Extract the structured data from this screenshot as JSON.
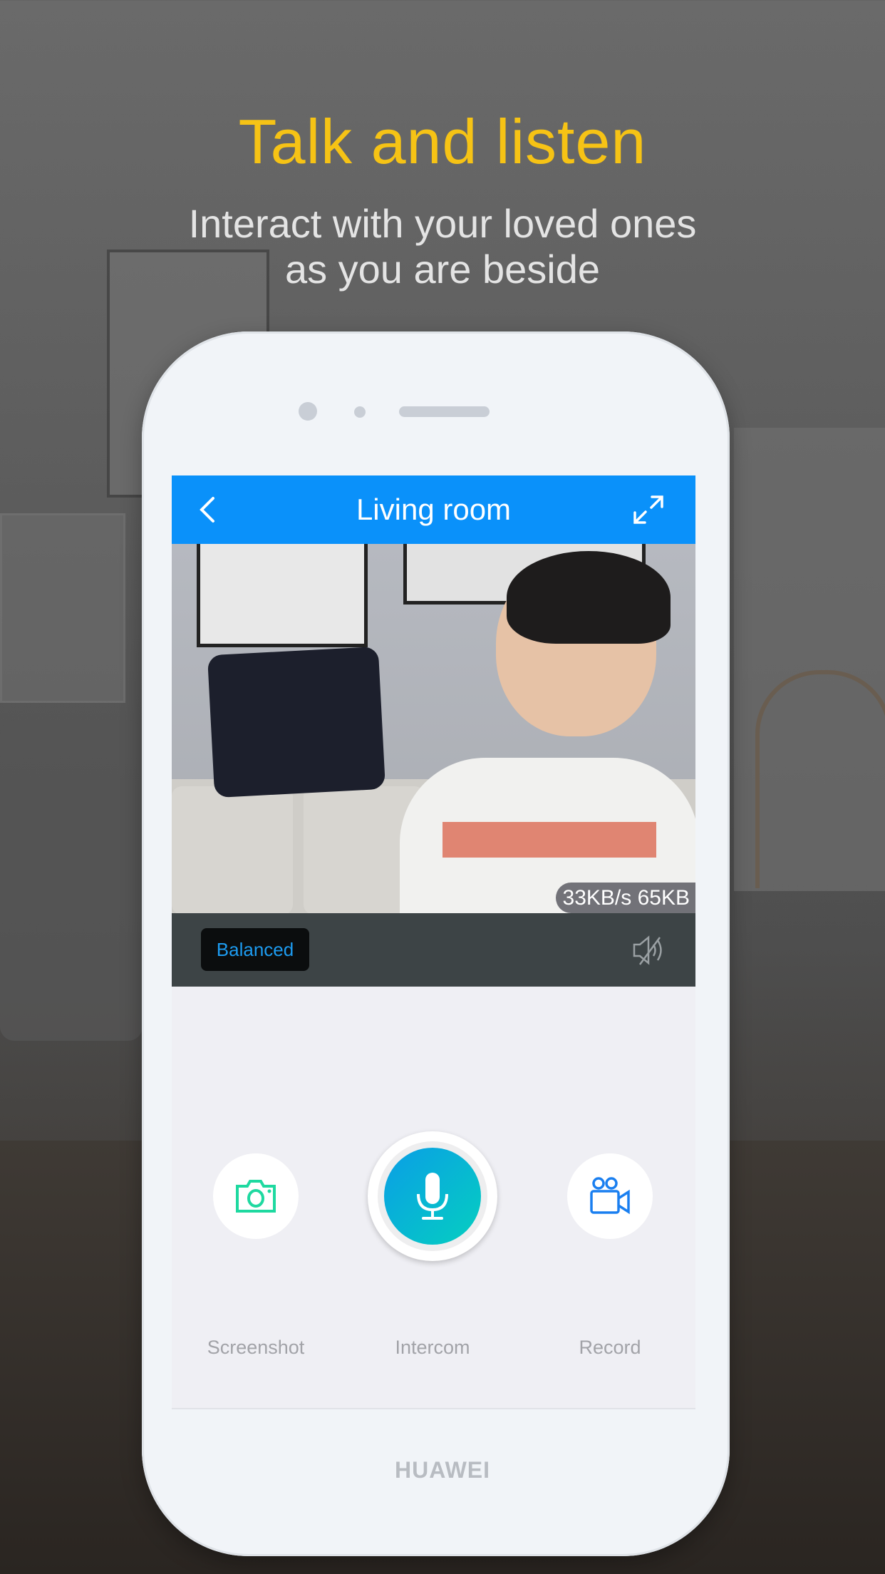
{
  "promo": {
    "headline": "Talk and listen",
    "subtitle_line1": "Interact with your loved ones",
    "subtitle_line2": "as you are beside"
  },
  "app": {
    "header": {
      "title": "Living room",
      "back_icon": "chevron-left-icon",
      "fullscreen_icon": "expand-icon"
    },
    "video": {
      "stream_stats": "33KB/s 65KB"
    },
    "controls": {
      "quality_label": "Balanced",
      "mute_icon": "speaker-muted-icon"
    },
    "actions": [
      {
        "label": "Screenshot",
        "icon": "camera-icon",
        "color": "#1ed9a0"
      },
      {
        "label": "Intercom",
        "icon": "microphone-icon",
        "color": "#0aa6e6"
      },
      {
        "label": "Record",
        "icon": "video-camera-icon",
        "color": "#1a7ff0"
      }
    ],
    "accent": "#0a91fa"
  },
  "device": {
    "brand": "HUAWEI"
  }
}
